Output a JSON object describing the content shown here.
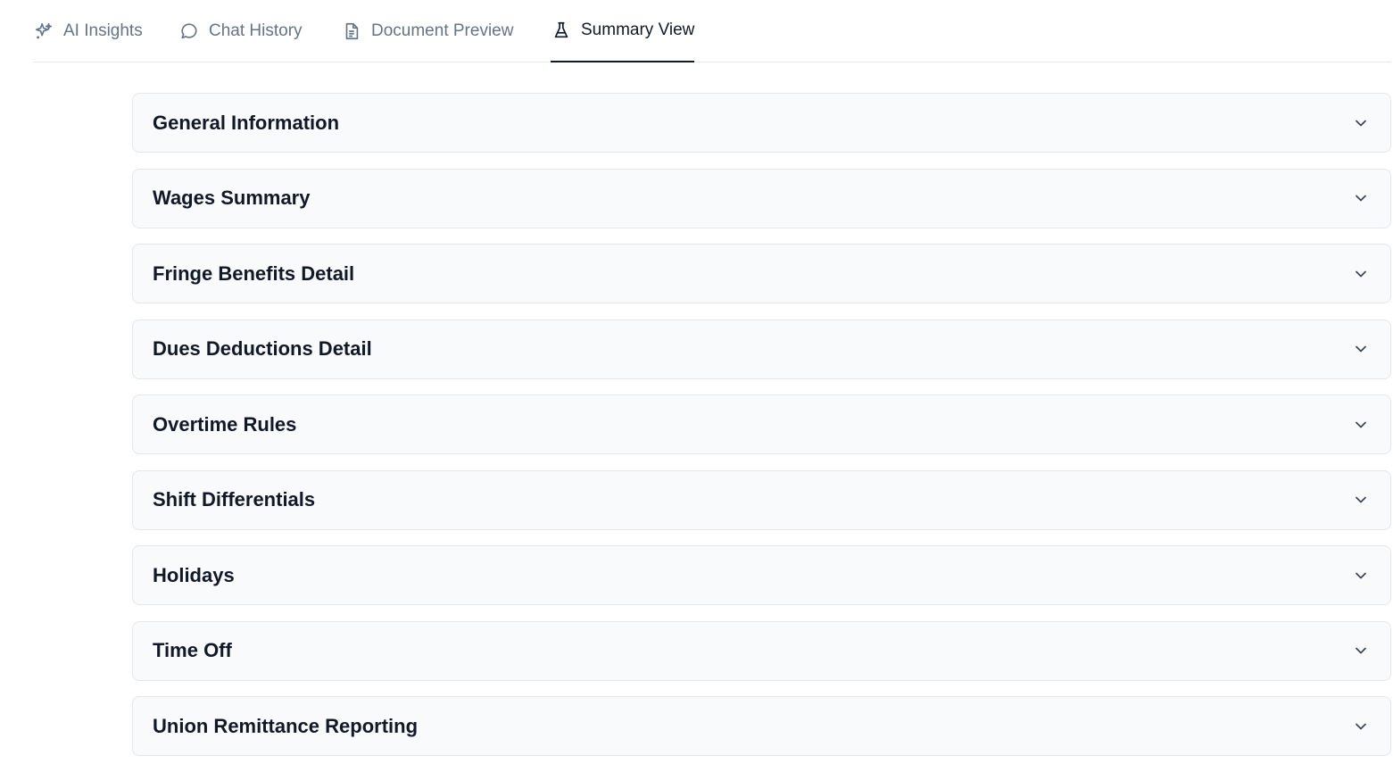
{
  "tabs": [
    {
      "label": "AI Insights",
      "icon": "sparkle-icon",
      "active": false
    },
    {
      "label": "Chat History",
      "icon": "chat-bubble-icon",
      "active": false
    },
    {
      "label": "Document Preview",
      "icon": "document-icon",
      "active": false
    },
    {
      "label": "Summary View",
      "icon": "flask-icon",
      "active": true
    }
  ],
  "sections": [
    {
      "title": "General Information"
    },
    {
      "title": "Wages Summary"
    },
    {
      "title": "Fringe Benefits Detail"
    },
    {
      "title": "Dues Deductions Detail"
    },
    {
      "title": "Overtime Rules"
    },
    {
      "title": "Shift Differentials"
    },
    {
      "title": "Holidays"
    },
    {
      "title": "Time Off"
    },
    {
      "title": "Union Remittance Reporting"
    }
  ],
  "colors": {
    "active_tab": "#111827",
    "inactive_tab": "#64748b",
    "panel_bg": "#f8fafc",
    "panel_border": "#e5e7eb"
  }
}
